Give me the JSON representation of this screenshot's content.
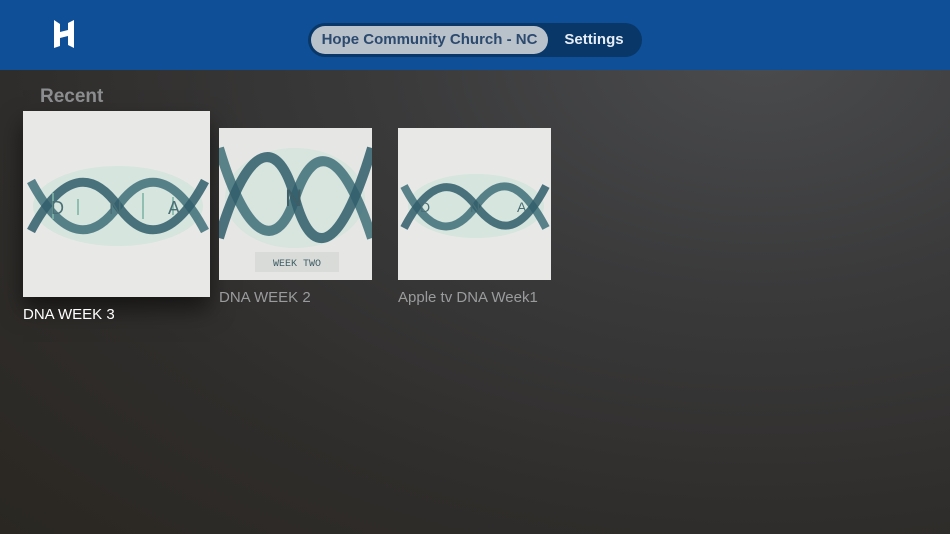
{
  "header": {
    "logo_icon": "church-logo-icon",
    "tabs": [
      {
        "label": "Hope Community Church - NC",
        "selected": true
      },
      {
        "label": "Settings",
        "selected": false
      }
    ],
    "accent": "#0e4f97"
  },
  "recent": {
    "title": "Recent",
    "items": [
      {
        "title": "DNA WEEK 3",
        "art_letters": [
          "D",
          "N",
          "A"
        ],
        "focused": true
      },
      {
        "title": "DNA WEEK 2",
        "art_letters": [
          "N"
        ],
        "art_subtitle": "WEEK TWO",
        "focused": false
      },
      {
        "title": "Apple tv DNA Week1",
        "art_letters": [
          "D",
          "N",
          "A"
        ],
        "focused": false
      }
    ]
  }
}
